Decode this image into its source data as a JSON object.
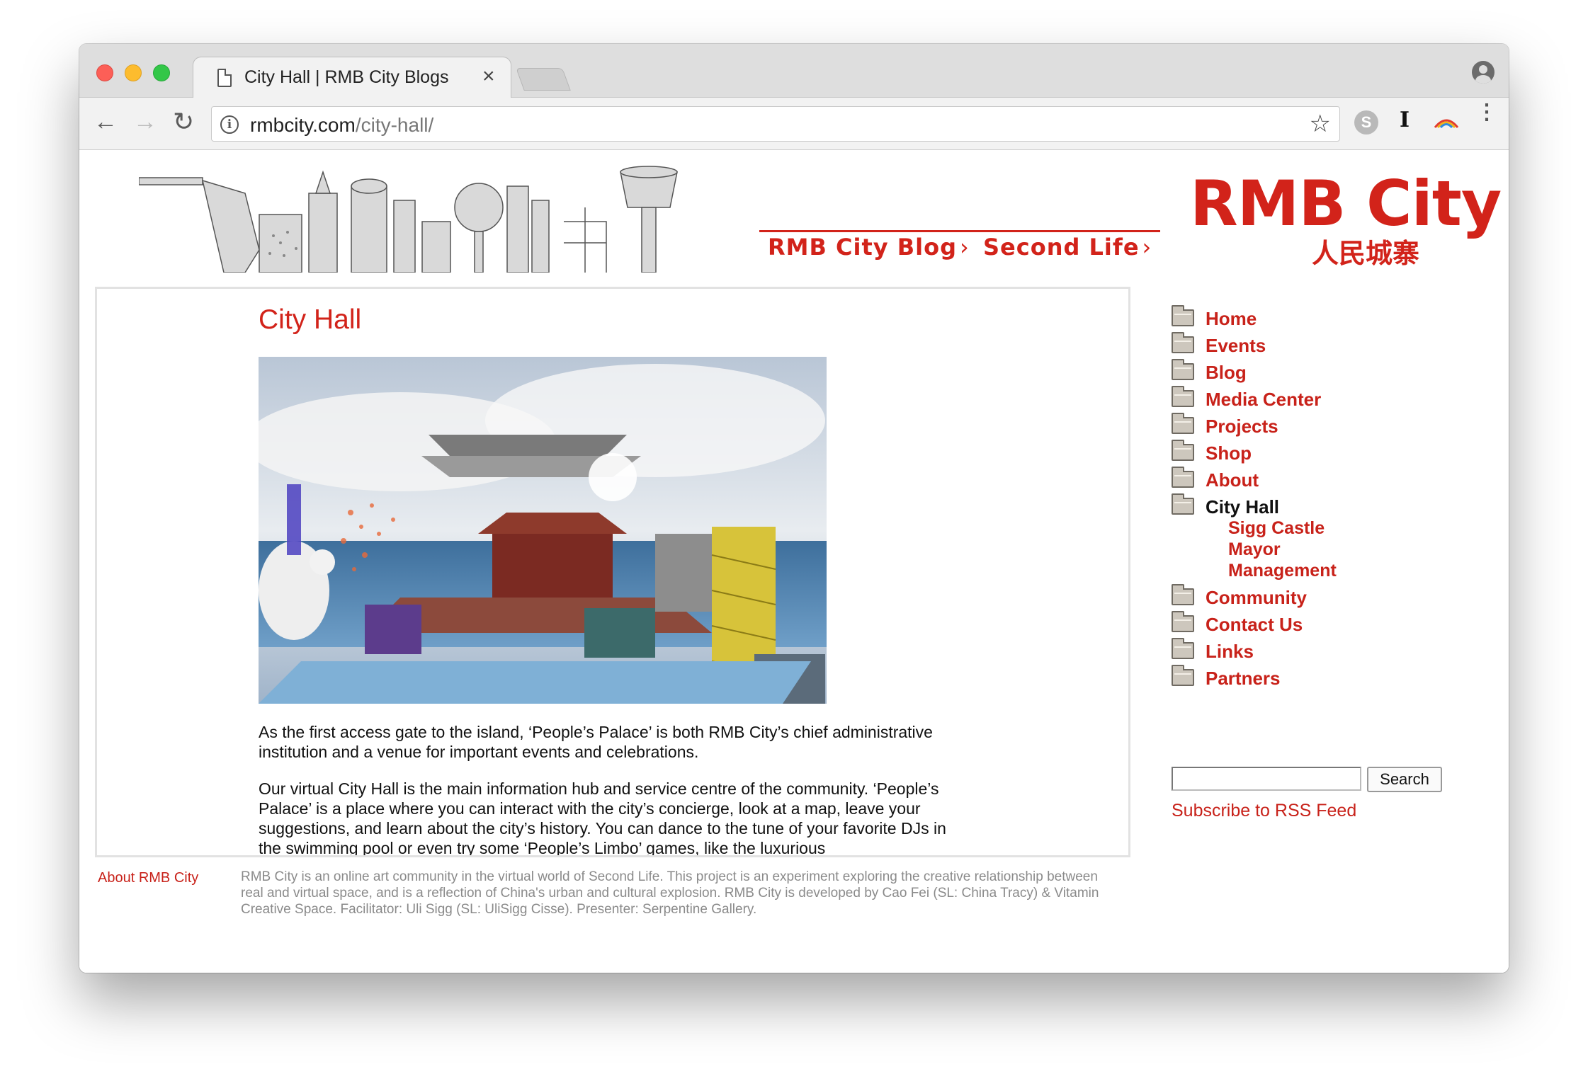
{
  "browser": {
    "tab_title": "City Hall | RMB City Blogs",
    "tab_close": "×",
    "url_host": "rmbcity.com",
    "url_path": "/city-hall/",
    "back": "←",
    "forward": "→",
    "reload": "↻",
    "star": "☆",
    "info": "i",
    "ext_skype": "S",
    "ext_ibeam": "I",
    "menu": "⋮"
  },
  "header": {
    "blog_link": "RMB City Blog",
    "second_life_link": "Second Life",
    "logo_title": "RMB City",
    "logo_chinese": "人民城寨"
  },
  "post": {
    "title": "City Hall",
    "paragraph_1": "As the first access gate to the island, ‘People’s Palace’ is both RMB City’s chief administrative institution and a venue for important events and celebrations.",
    "paragraph_2": "Our virtual City Hall is the main information hub and service centre of the community. ‘People’s Palace’ is a place where you can interact with the city’s concierge, look at a map, leave your suggestions, and learn about the city’s history. You can dance to the tune of your favorite DJs in the swimming pool or even try some ‘People’s Limbo’ games, like the luxurious"
  },
  "sidebar": {
    "items": [
      {
        "label": "Home"
      },
      {
        "label": "Events"
      },
      {
        "label": "Blog"
      },
      {
        "label": "Media Center"
      },
      {
        "label": "Projects"
      },
      {
        "label": "Shop"
      },
      {
        "label": "About"
      },
      {
        "label": "City Hall"
      },
      {
        "label": "Community"
      },
      {
        "label": "Contact Us"
      },
      {
        "label": "Links"
      },
      {
        "label": "Partners"
      }
    ],
    "subitems": [
      {
        "label": "Sigg Castle"
      },
      {
        "label": "Mayor"
      },
      {
        "label": "Management"
      }
    ],
    "search_value": "",
    "search_button": "Search",
    "rss_link": "Subscribe to RSS Feed"
  },
  "footer": {
    "label": "About RMB City",
    "text": "RMB City is an online art community in the virtual world of Second Life. This project is an experiment exploring the creative relationship between real and virtual space, and is a reflection of China's urban and cultural explosion. RMB City is developed by Cao Fei (SL: China Tracy) & Vitamin Creative Space. Facilitator: Uli Sigg (SL: UliSigg Cisse). Presenter: Serpentine Gallery."
  },
  "colors": {
    "accent_red": "#d2231a",
    "link_red": "#c8221a",
    "footer_gray": "#8a8a8a"
  },
  "icons": [
    "page-icon",
    "close-icon",
    "back-icon",
    "forward-icon",
    "reload-icon",
    "info-icon",
    "star-icon",
    "skype-icon",
    "ibeam-icon",
    "rainbow-icon",
    "menu-icon",
    "profile-icon",
    "folder-icon"
  ]
}
